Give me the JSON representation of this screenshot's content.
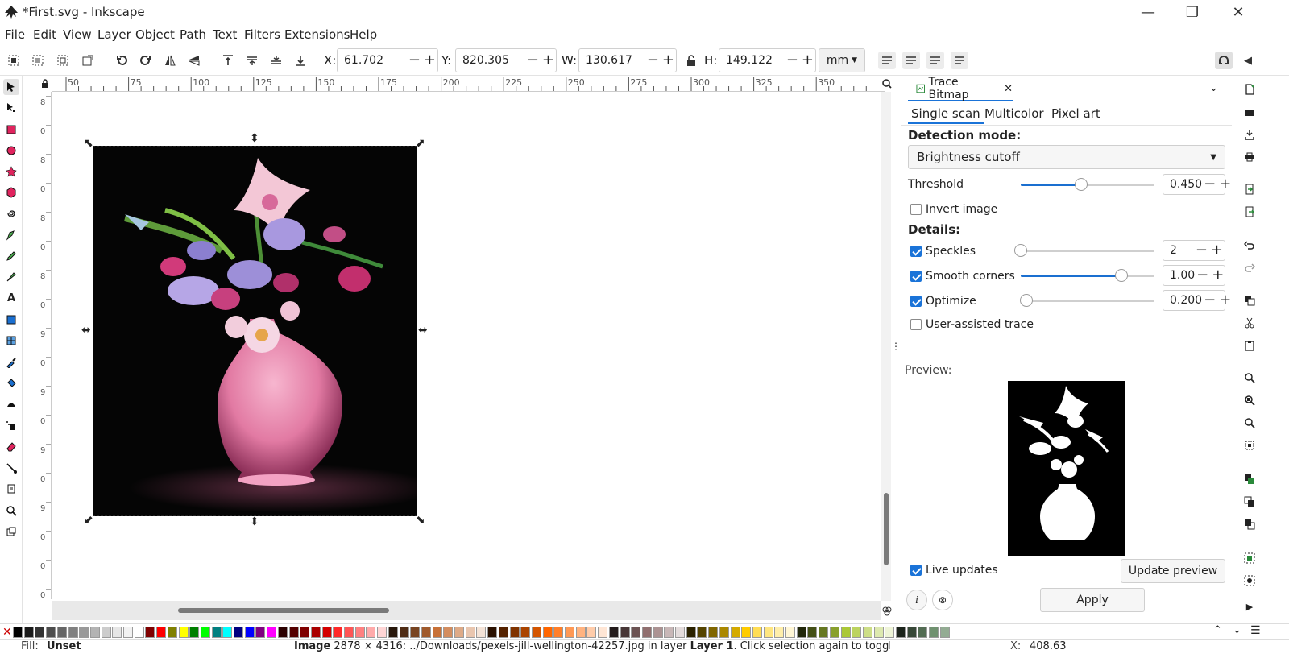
{
  "window": {
    "title": "*First.svg - Inkscape"
  },
  "menu": [
    "File",
    "Edit",
    "View",
    "Layer",
    "Object",
    "Path",
    "Text",
    "Filters",
    "Extensions",
    "Help"
  ],
  "toolctl": {
    "x_label": "X:",
    "x_value": "61.702",
    "y_label": "Y:",
    "y_value": "820.305",
    "w_label": "W:",
    "w_value": "130.617",
    "h_label": "H:",
    "h_value": "149.122",
    "unit": "mm"
  },
  "ruler": {
    "h_labels": [
      "50",
      "75",
      "100",
      "125",
      "150",
      "175",
      "200",
      "225",
      "250",
      "275",
      "300",
      "325",
      "350"
    ],
    "v_labels": [
      "8",
      "0",
      "8",
      "0",
      "8",
      "0",
      "8",
      "0",
      "9",
      "0",
      "9",
      "0",
      "9",
      "0",
      "9",
      "0",
      "0",
      "0"
    ]
  },
  "dock": {
    "tab_title": "Trace Bitmap",
    "subtabs": [
      "Single scan",
      "Multicolor",
      "Pixel art"
    ],
    "detection_label": "Detection mode:",
    "detection_value": "Brightness cutoff",
    "threshold_label": "Threshold",
    "threshold_value": "0.450",
    "threshold_level": 0.45,
    "invert_label": "Invert image",
    "details_label": "Details:",
    "speckles_label": "Speckles",
    "speckles_value": "2",
    "speckles_level": 0.0,
    "smooth_label": "Smooth corners",
    "smooth_value": "1.00",
    "smooth_level": 0.75,
    "optimize_label": "Optimize",
    "optimize_value": "0.200",
    "optimize_level": 0.04,
    "user_assisted_label": "User-assisted trace",
    "preview_label": "Preview:",
    "live_updates_label": "Live updates",
    "update_preview_label": "Update preview",
    "apply_label": "Apply"
  },
  "statusbar": {
    "fill_label": "Fill:",
    "fill_value": "Unset",
    "message_prefix": "Image",
    "message": " 2878 × 4316: ../Downloads/pexels-jill-wellington-42257.jpg in layer ",
    "layer": "Layer 1",
    "message_suffix": ". Click selection again to toggle",
    "coord_label": "X:",
    "coord_value": "408.63"
  },
  "colors": {
    "accent": "#1a73d8",
    "selection": "#000000"
  },
  "palette": [
    "#000000",
    "#1a1a1a",
    "#333333",
    "#4d4d4d",
    "#666666",
    "#808080",
    "#999999",
    "#b3b3b3",
    "#cccccc",
    "#e6e6e6",
    "#f2f2f2",
    "#ffffff",
    "#800000",
    "#ff0000",
    "#808000",
    "#ffff00",
    "#008000",
    "#00ff00",
    "#008080",
    "#00ffff",
    "#000080",
    "#0000ff",
    "#800080",
    "#ff00ff",
    "#2b0000",
    "#550000",
    "#800000",
    "#aa0000",
    "#d40000",
    "#ff2a2a",
    "#ff5555",
    "#ff8080",
    "#ffaaaa",
    "#ffd5d5",
    "#28170b",
    "#502d16",
    "#784421",
    "#a05a2c",
    "#c87137",
    "#d38d5f",
    "#deaa87",
    "#e9c6af",
    "#f4e3d7",
    "#2b1100",
    "#552200",
    "#803300",
    "#aa4400",
    "#d45500",
    "#ff6600",
    "#ff7f2a",
    "#ff9955",
    "#ffb380",
    "#ffccaa",
    "#ffe6d5",
    "#241c1c",
    "#483737",
    "#6c5353",
    "#916f6f",
    "#ac9393",
    "#c8b7b7",
    "#e3dbdb",
    "#2b2200",
    "#554400",
    "#806600",
    "#aa8800",
    "#d4aa00",
    "#ffcc00",
    "#ffdd55",
    "#ffe680",
    "#ffeeaa",
    "#fff6d5",
    "#22280b",
    "#445016",
    "#667821",
    "#89a02c",
    "#abc837",
    "#bcd35f",
    "#cdde87",
    "#dde9af",
    "#eef4d7",
    "#1c241c",
    "#374837",
    "#536c53",
    "#6f916f",
    "#93ac93"
  ]
}
